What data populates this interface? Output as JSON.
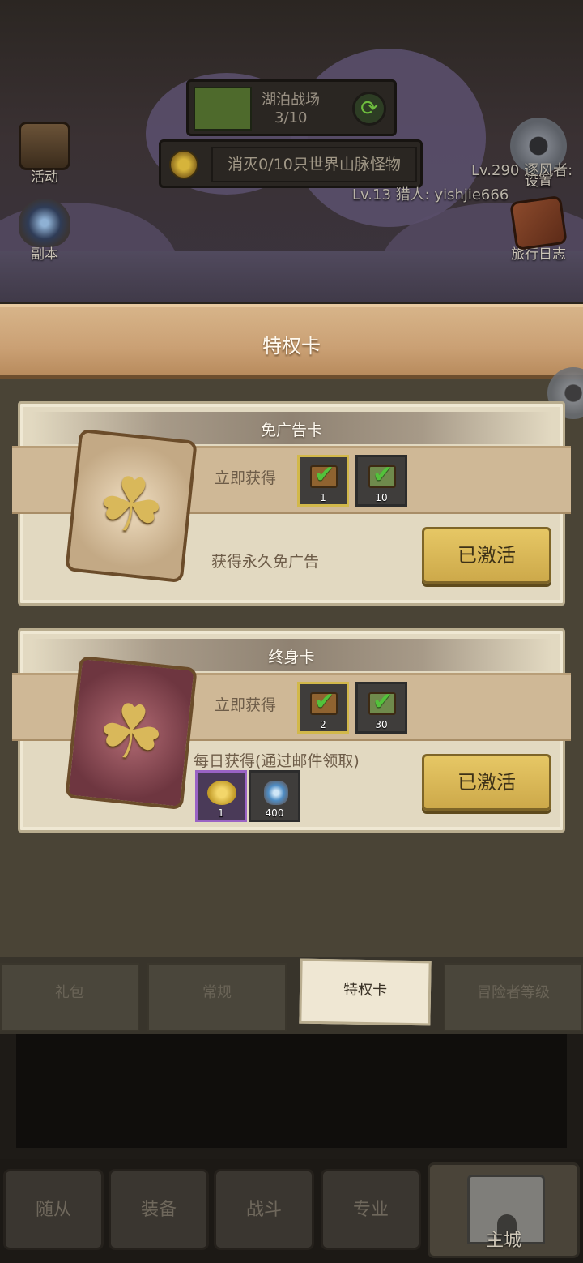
{
  "scene": {
    "quest_name": "湖泊战场",
    "quest_progress": "3/10",
    "task_text": "消灭0/10只世界山脉怪物",
    "player_line_1": "Lv.290 逐风者:",
    "player_line_2": "Lv.13 猎人: yishjie666",
    "left_buttons": [
      "活动",
      "副本"
    ],
    "right_buttons": [
      "设置",
      "旅行日志"
    ]
  },
  "modal": {
    "title": "特权卡",
    "cards": [
      {
        "name": "免广告卡",
        "instant_label": "立即获得",
        "instant_items": [
          {
            "icon": "chest-check-icon",
            "count": "1"
          },
          {
            "icon": "ticket-check-icon",
            "count": "10"
          }
        ],
        "description": "获得永久免广告",
        "button": "已激活"
      },
      {
        "name": "终身卡",
        "instant_label": "立即获得",
        "instant_items": [
          {
            "icon": "chest-check-icon",
            "count": "2"
          },
          {
            "icon": "ticket-check-icon",
            "count": "30"
          }
        ],
        "daily_label": "每日获得(通过邮件领取)",
        "daily_items": [
          {
            "icon": "gold-coins-icon",
            "count": "1"
          },
          {
            "icon": "gem-icon",
            "count": "400"
          }
        ],
        "button": "已激活"
      }
    ]
  },
  "tabs": [
    "礼包",
    "常规",
    "特权卡",
    "冒险者等级"
  ],
  "active_tab": "特权卡",
  "bottom_nav": [
    "随从",
    "装备",
    "战斗",
    "专业",
    "主城"
  ],
  "colors": {
    "accent_gold": "#e6c765",
    "header_tan": "#caa074",
    "card_bg": "#e2d9c1"
  }
}
